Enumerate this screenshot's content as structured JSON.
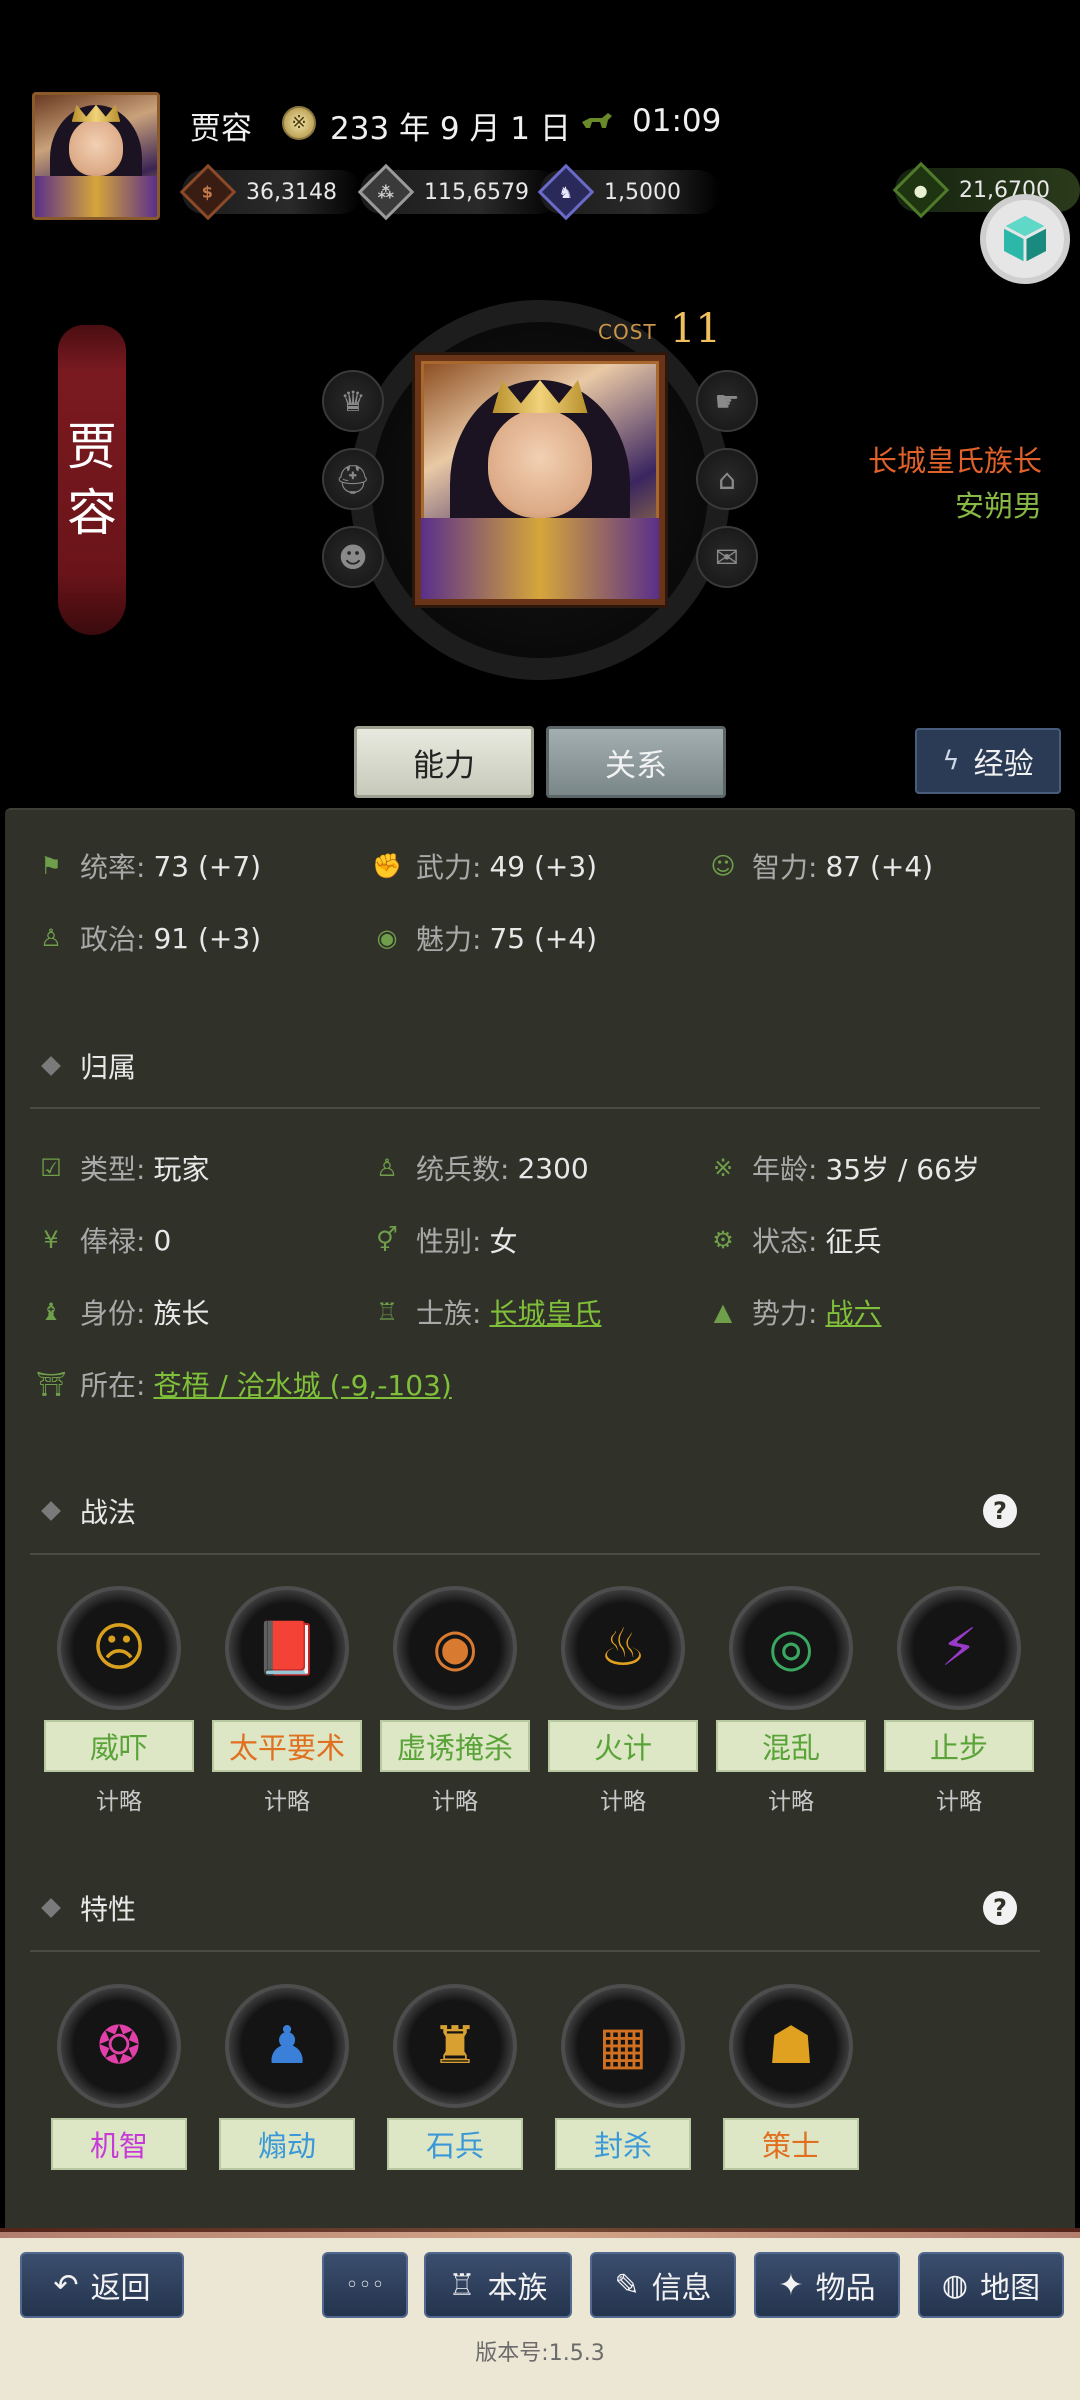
{
  "header": {
    "name": "贾容",
    "date": "233 年 9 月 1 日",
    "time": "01:09",
    "resources": [
      {
        "name": "gold-icon",
        "value": "36,3148",
        "color": "#8a4a2a"
      },
      {
        "name": "grain-icon",
        "value": "115,6579",
        "color": "#9a9a9a"
      },
      {
        "name": "troops-icon",
        "value": "1,5000",
        "color": "#5a5aa8"
      },
      {
        "name": "money-bag-icon",
        "value": "21,6700",
        "color": "#4f7a2a"
      }
    ]
  },
  "hero": {
    "banner_chars": [
      "贾",
      "容"
    ],
    "cost_label": "COST",
    "cost_value": "11",
    "title_clan": "长城皇氏族长",
    "title_rank": "安朔男"
  },
  "tabs": {
    "ability": "能力",
    "relation": "关系",
    "exp": "经验"
  },
  "stats": [
    {
      "icon": "flag-icon",
      "label": "统率:",
      "value": "73 (+7)"
    },
    {
      "icon": "arm-icon",
      "label": "武力:",
      "value": "49 (+3)"
    },
    {
      "icon": "brain-icon",
      "label": "智力:",
      "value": "87 (+4)"
    },
    {
      "icon": "bag-icon",
      "label": "政治:",
      "value": "91 (+3)"
    },
    {
      "icon": "eye-icon",
      "label": "魅力:",
      "value": "75 (+4)"
    }
  ],
  "affiliation": {
    "title": "归属",
    "type_label": "类型:",
    "type_value": "玩家",
    "troops_label": "统兵数:",
    "troops_value": "2300",
    "age_label": "年龄:",
    "age_value": "35岁 / 66岁",
    "salary_label": "俸禄:",
    "salary_value": "0",
    "gender_label": "性别:",
    "gender_value": "女",
    "status_label": "状态:",
    "status_value": "征兵",
    "identity_label": "身份:",
    "identity_value": "族长",
    "clan_label": "士族:",
    "clan_value": "长城皇氏",
    "force_label": "势力:",
    "force_value": "战六",
    "location_label": "所在:",
    "location_value": "苍梧 / 洽水城 (-9,-103)"
  },
  "tactics": {
    "title": "战法",
    "items": [
      {
        "name": "威吓",
        "type": "计略",
        "color": "#5aa338",
        "icon": "screaming-face-icon",
        "glyph": "☹",
        "glyph_color": "#d9a020"
      },
      {
        "name": "太平要术",
        "type": "计略",
        "color": "#e07020",
        "icon": "spellbook-icon",
        "glyph": "📕",
        "glyph_color": "#e07020"
      },
      {
        "name": "虚诱掩杀",
        "type": "计略",
        "color": "#5aa338",
        "icon": "mask-icon",
        "glyph": "◉",
        "glyph_color": "#d87a30"
      },
      {
        "name": "火计",
        "type": "计略",
        "color": "#5aa338",
        "icon": "fire-icon",
        "glyph": "♨",
        "glyph_color": "#e0a020"
      },
      {
        "name": "混乱",
        "type": "计略",
        "color": "#5aa338",
        "icon": "swirl-icon",
        "glyph": "◎",
        "glyph_color": "#3aa860"
      },
      {
        "name": "止步",
        "type": "计略",
        "color": "#5aa338",
        "icon": "boot-icon",
        "glyph": "⚡",
        "glyph_color": "#9a3ac8"
      }
    ]
  },
  "traits": {
    "title": "特性",
    "items": [
      {
        "name": "机智",
        "color": "#c83ad8",
        "icon": "brain-icon",
        "glyph": "❂",
        "glyph_color": "#e040a8"
      },
      {
        "name": "煽动",
        "color": "#3a98d8",
        "icon": "speaker-icon",
        "glyph": "♟",
        "glyph_color": "#3a80d8"
      },
      {
        "name": "石兵",
        "color": "#3a98d8",
        "icon": "statue-icon",
        "glyph": "♜",
        "glyph_color": "#d8a030"
      },
      {
        "name": "封杀",
        "color": "#3a98d8",
        "icon": "crate-icon",
        "glyph": "▦",
        "glyph_color": "#d07020"
      },
      {
        "name": "策士",
        "color": "#e07020",
        "icon": "scholar-hat-icon",
        "glyph": "☗",
        "glyph_color": "#e0a020"
      }
    ]
  },
  "nav": {
    "back": "返回",
    "more": "◦◦◦",
    "clan": "本族",
    "info": "信息",
    "items": "物品",
    "map": "地图"
  },
  "version": "版本号:1.5.3"
}
